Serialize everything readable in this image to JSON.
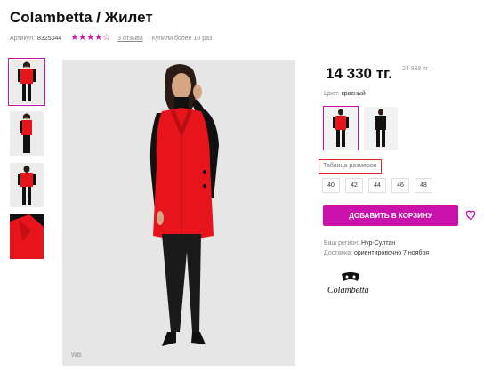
{
  "product": {
    "title": "Colambetta / Жилет",
    "sku_label": "Артикул:",
    "sku_value": "8325044",
    "rating": 4,
    "rating_max": 5,
    "reviews": "3 отзыва",
    "bought": "Купили более 10 раз"
  },
  "gallery": {
    "watermark": "WB",
    "thumbs": [
      "thumb-front",
      "thumb-side",
      "thumb-back",
      "thumb-detail"
    ]
  },
  "pricing": {
    "price": "14 330 тг.",
    "old_price": "24 888 тг."
  },
  "color": {
    "label": "Цвет:",
    "value": "красный"
  },
  "sizes": {
    "table_label": "Таблица размеров",
    "options": [
      "40",
      "42",
      "44",
      "46",
      "48"
    ]
  },
  "cart": {
    "button_label": "ДОБАВИТЬ В КОРЗИНУ"
  },
  "delivery": {
    "region_label": "Ваш регион:",
    "region_value": "Нур-Султан",
    "delivery_label": "Доставка:",
    "delivery_value": "ориентировочно 7 ноября"
  },
  "brand": {
    "logo_text": "Colambetta"
  },
  "colors": {
    "accent": "#cb11ab",
    "vest": "#e8141c"
  }
}
